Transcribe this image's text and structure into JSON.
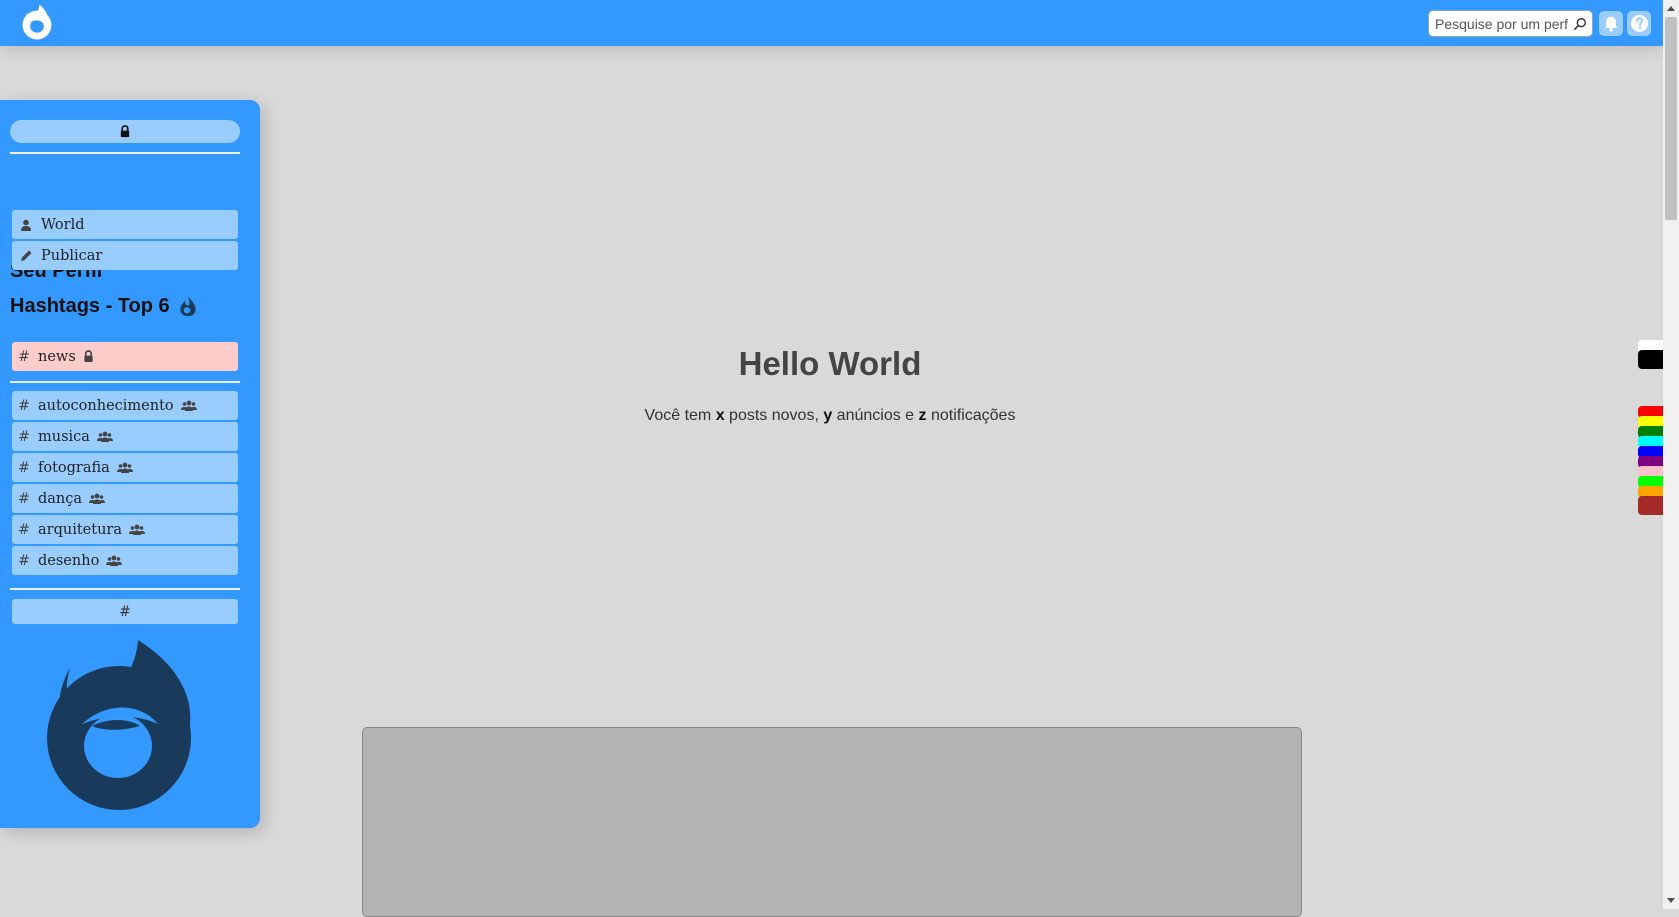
{
  "topbar": {
    "search_placeholder": "Pesquise por um perfil",
    "logo_icon": "flame-logo-icon",
    "bell_icon": "bell-icon",
    "help_icon": "help-icon"
  },
  "sidebar": {
    "lock_icon": "lock-icon",
    "profile_title": "Seu Perfil",
    "profile_items": [
      {
        "label": "World",
        "icon": "user-icon"
      },
      {
        "label": "Publicar",
        "icon": "pencil-icon"
      }
    ],
    "hashtags_title": "Hashtags - Top 6",
    "private_hashtag": {
      "label": "news",
      "icon": "lock-icon"
    },
    "hashtags": [
      {
        "label": "autoconhecimento",
        "icon": "users-icon"
      },
      {
        "label": "musica",
        "icon": "users-icon"
      },
      {
        "label": "fotografia",
        "icon": "users-icon"
      },
      {
        "label": "dança",
        "icon": "users-icon"
      },
      {
        "label": "arquitetura",
        "icon": "users-icon"
      },
      {
        "label": "desenho",
        "icon": "users-icon"
      }
    ],
    "hash_symbol": "#",
    "hash_button_label": "#"
  },
  "main": {
    "title": "Hello World",
    "sub_prefix": "Você tem ",
    "x": "x",
    "sub_mid1": " posts novos, ",
    "y": "y",
    "sub_mid2": " anúncios e ",
    "z": "z",
    "sub_suffix": " notificações"
  },
  "colors": {
    "accent": "#3399ff",
    "item_bg": "#99ccff",
    "private_bg": "#ffcccc",
    "logo_dark": "#1a3a5c"
  },
  "palette": [
    "#ffffff",
    "#000000",
    "#ff0000",
    "#ffff00",
    "#008000",
    "#00ffff",
    "#0000ff",
    "#800080",
    "#ffc0cb",
    "#00ff00",
    "#ffa500",
    "#a52a2a"
  ]
}
